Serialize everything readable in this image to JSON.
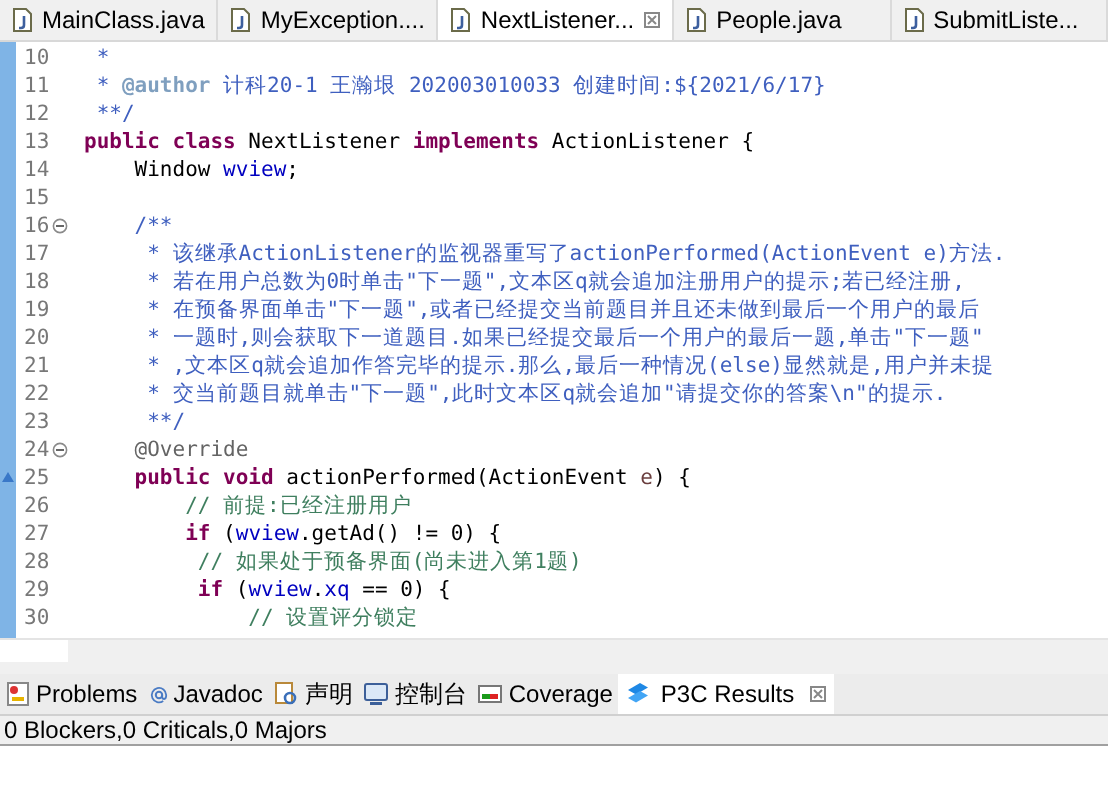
{
  "editor_tabs": [
    {
      "label": "MainClass.java",
      "selected": false
    },
    {
      "label": "MyException....",
      "selected": false
    },
    {
      "label": "NextListener...",
      "selected": true
    },
    {
      "label": "People.java",
      "selected": false
    },
    {
      "label": "SubmitListe...",
      "selected": false
    }
  ],
  "code_lines": [
    {
      "number": "10",
      "kind": "plain",
      "tokens": [
        {
          "kind": "javadoc",
          "text": " *"
        }
      ]
    },
    {
      "number": "11",
      "kind": "plain",
      "tokens": [
        {
          "kind": "javadoc",
          "text": " * "
        },
        {
          "kind": "javadoc_tag",
          "text": "@author"
        },
        {
          "kind": "javadoc",
          "text": " 计科20-1 王瀚垠 202003010033 创建时间:${2021/6/17}"
        }
      ]
    },
    {
      "number": "12",
      "kind": "plain",
      "tokens": [
        {
          "kind": "javadoc",
          "text": " **/"
        }
      ]
    },
    {
      "number": "13",
      "kind": "plain",
      "tokens": [
        {
          "kind": "keyword",
          "text": "public class"
        },
        {
          "kind": "plain",
          "text": " NextListener "
        },
        {
          "kind": "keyword",
          "text": "implements"
        },
        {
          "kind": "plain",
          "text": " ActionListener {"
        }
      ]
    },
    {
      "number": "14",
      "kind": "plain",
      "tokens": [
        {
          "kind": "plain",
          "text": "    Window "
        },
        {
          "kind": "field",
          "text": "wview"
        },
        {
          "kind": "plain",
          "text": ";"
        }
      ]
    },
    {
      "number": "15",
      "kind": "plain"
    },
    {
      "number": "16",
      "kind": "fold",
      "tokens": [
        {
          "kind": "javadoc",
          "text": "    /**"
        }
      ]
    },
    {
      "number": "17",
      "kind": "plain",
      "tokens": [
        {
          "kind": "javadoc",
          "text": "     * 该继承ActionListener的监视器重写了actionPerformed(ActionEvent e)方法."
        }
      ]
    },
    {
      "number": "18",
      "kind": "plain",
      "tokens": [
        {
          "kind": "javadoc",
          "text": "     * 若在用户总数为0时单击\"下一题\",文本区q就会追加注册用户的提示;若已经注册,"
        }
      ]
    },
    {
      "number": "19",
      "kind": "plain",
      "tokens": [
        {
          "kind": "javadoc",
          "text": "     * 在预备界面单击\"下一题\",或者已经提交当前题目并且还未做到最后一个用户的最后"
        }
      ]
    },
    {
      "number": "20",
      "kind": "plain",
      "tokens": [
        {
          "kind": "javadoc",
          "text": "     * 一题时,则会获取下一道题目.如果已经提交最后一个用户的最后一题,单击\"下一题\""
        }
      ]
    },
    {
      "number": "21",
      "kind": "plain",
      "tokens": [
        {
          "kind": "javadoc",
          "text": "     * ,文本区q就会追加作答完毕的提示.那么,最后一种情况(else)显然就是,用户并未提"
        }
      ]
    },
    {
      "number": "22",
      "kind": "plain",
      "tokens": [
        {
          "kind": "javadoc",
          "text": "     * 交当前题目就单击\"下一题\",此时文本区q就会追加\"请提交你的答案\\n\"的提示."
        }
      ]
    },
    {
      "number": "23",
      "kind": "plain",
      "tokens": [
        {
          "kind": "javadoc",
          "text": "     **/"
        }
      ]
    },
    {
      "number": "24",
      "kind": "fold",
      "tokens": [
        {
          "kind": "annotation",
          "text": "    @Override"
        }
      ]
    },
    {
      "number": "25",
      "kind": "override",
      "tokens": [
        {
          "kind": "keyword",
          "text": "    public void"
        },
        {
          "kind": "plain",
          "text": " actionPerformed(ActionEvent "
        },
        {
          "kind": "param",
          "text": "e"
        },
        {
          "kind": "plain",
          "text": ") {"
        }
      ]
    },
    {
      "number": "26",
      "kind": "plain",
      "tokens": [
        {
          "kind": "comment",
          "text": "        // 前提:已经注册用户"
        }
      ]
    },
    {
      "number": "27",
      "kind": "plain",
      "tokens": [
        {
          "kind": "keyword",
          "text": "        if"
        },
        {
          "kind": "plain",
          "text": " ("
        },
        {
          "kind": "field",
          "text": "wview"
        },
        {
          "kind": "plain",
          "text": ".getAd() != 0) {"
        }
      ]
    },
    {
      "number": "28",
      "kind": "plain",
      "tokens": [
        {
          "kind": "comment",
          "text": "         // 如果处于预备界面(尚未进入第1题)"
        }
      ]
    },
    {
      "number": "29",
      "kind": "plain",
      "tokens": [
        {
          "kind": "keyword",
          "text": "         if"
        },
        {
          "kind": "plain",
          "text": " ("
        },
        {
          "kind": "field",
          "text": "wview"
        },
        {
          "kind": "plain",
          "text": "."
        },
        {
          "kind": "field",
          "text": "xq"
        },
        {
          "kind": "plain",
          "text": " == 0) {"
        }
      ]
    },
    {
      "number": "30",
      "kind": "plain",
      "tokens": [
        {
          "kind": "comment",
          "text": "             // 设置评分锁定"
        }
      ]
    }
  ],
  "panel_tabs": [
    {
      "label": "Problems",
      "selected": false
    },
    {
      "label": "Javadoc",
      "selected": false
    },
    {
      "label": "声明",
      "selected": false
    },
    {
      "label": "控制台",
      "selected": false
    },
    {
      "label": "Coverage",
      "selected": false
    },
    {
      "label": "P3C Results",
      "selected": true
    }
  ],
  "panel_summary": "0 Blockers,0 Criticals,0 Majors"
}
